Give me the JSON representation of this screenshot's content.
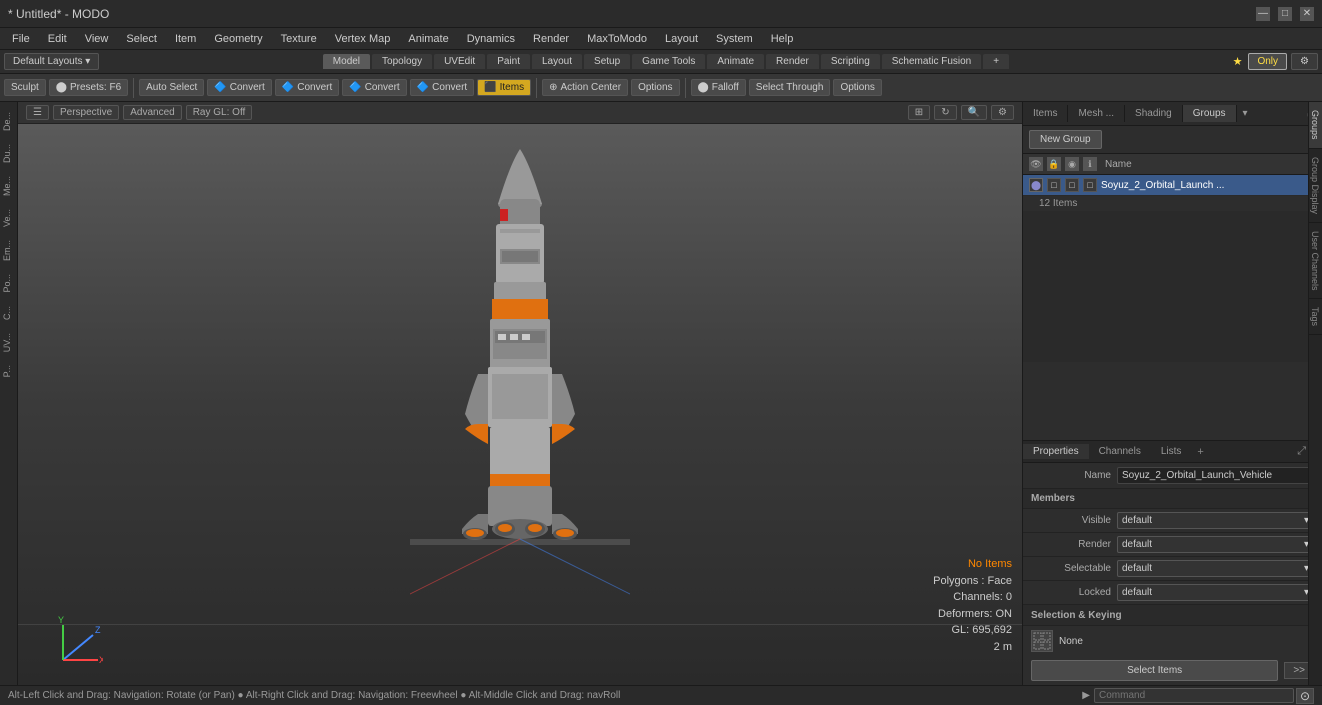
{
  "titlebar": {
    "title": "* Untitled* - MODO",
    "controls": [
      "—",
      "□",
      "✕"
    ]
  },
  "menubar": {
    "items": [
      "File",
      "Edit",
      "View",
      "Select",
      "Item",
      "Geometry",
      "Texture",
      "Vertex Map",
      "Animate",
      "Dynamics",
      "Render",
      "MaxToModo",
      "Layout",
      "System",
      "Help"
    ]
  },
  "layouts_bar": {
    "default_layout": "Default Layouts ▾",
    "tabs": [
      "Model",
      "Topology",
      "UVEdit",
      "Paint",
      "Layout",
      "Setup",
      "Game Tools",
      "Animate",
      "Render",
      "Scripting",
      "Schematic Fusion",
      "+"
    ],
    "active_tab": "Model",
    "only_label": "Only",
    "settings_icon": "⚙"
  },
  "toolbar": {
    "sculpt": "Sculpt",
    "presets": "Presets: F6",
    "auto_select": "Auto Select",
    "convert_btns": [
      "Convert",
      "Convert",
      "Convert",
      "Convert"
    ],
    "items": "Items",
    "action_center": "Action Center",
    "options1": "Options",
    "falloff": "Falloff",
    "select_through": "Select Through",
    "options2": "Options"
  },
  "viewport": {
    "header": {
      "perspective": "Perspective",
      "advanced": "Advanced",
      "ray_off": "Ray GL: Off"
    },
    "info": {
      "no_items": "No Items",
      "polygons": "Polygons : Face",
      "channels": "Channels: 0",
      "deformers": "Deformers: ON",
      "gl": "GL: 695,692",
      "units": "2 m"
    }
  },
  "left_sidebar": {
    "tabs": [
      "De...",
      "Du...",
      "Me...",
      "Ve...",
      "Em...",
      "Po...",
      "C...",
      "UV...",
      "P..."
    ]
  },
  "right_panel": {
    "tabs": [
      "Items",
      "Mesh ...",
      "Shading",
      "Groups"
    ],
    "active_tab": "Groups",
    "expand_icon": "⤢",
    "new_group_label": "New Group",
    "name_column": "Name",
    "group_name": "Soyuz_2_Orbital_Launch ...",
    "group_sub": "12 Items"
  },
  "properties": {
    "tabs": [
      "Properties",
      "Channels",
      "Lists",
      "+"
    ],
    "active_tab": "Properties",
    "name_label": "Name",
    "name_value": "Soyuz_2_Orbital_Launch_Vehicle",
    "members_section": "Members",
    "visible_label": "Visible",
    "visible_value": "default",
    "render_label": "Render",
    "render_value": "default",
    "selectable_label": "Selectable",
    "selectable_value": "default",
    "locked_label": "Locked",
    "locked_value": "default",
    "selection_keying_section": "Selection & Keying",
    "none_label": "None",
    "select_items_label": "Select Items"
  },
  "side_tabs": [
    "Groups",
    "Group Display",
    "User Channels",
    "Tags"
  ],
  "status_bar": {
    "message": "Alt-Left Click and Drag: Navigation: Rotate (or Pan) ● Alt-Right Click and Drag: Navigation: Freewheel ● Alt-Middle Click and Drag: navRoll",
    "command_placeholder": "Command",
    "right_icon": "⊙"
  }
}
